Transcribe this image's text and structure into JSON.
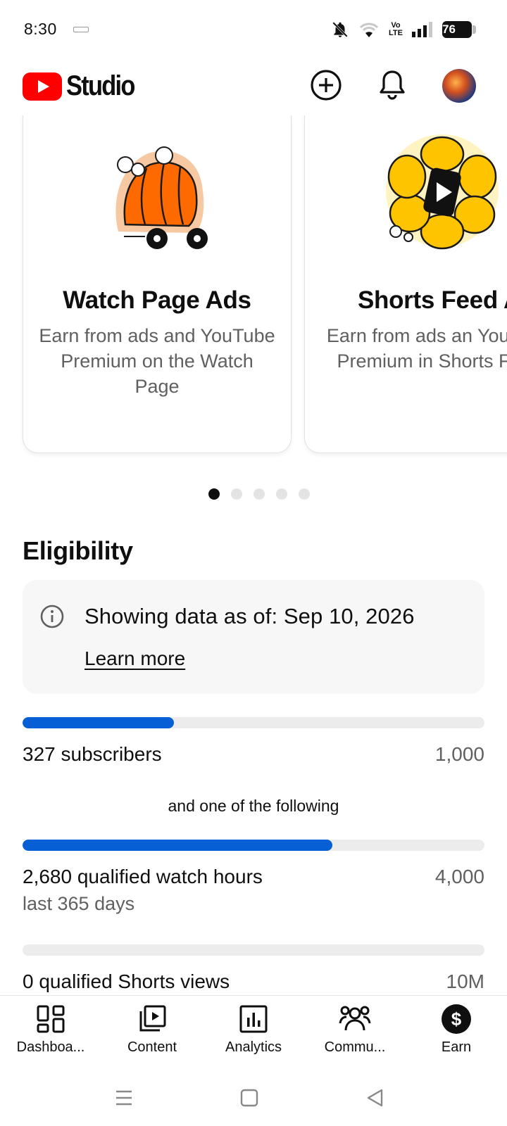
{
  "status_bar": {
    "time": "8:30",
    "network_label": "Vo\nLTE",
    "battery": "76",
    "icons": [
      "notifications-off-icon",
      "wifi-icon",
      "volte-icon",
      "signal-icon",
      "battery-icon"
    ]
  },
  "header": {
    "app_name": "Studio",
    "icons": [
      "create-icon",
      "notifications-icon",
      "avatar"
    ],
    "brand_color": "#ff0000"
  },
  "carousel": {
    "cards": [
      {
        "title": "Watch Page Ads",
        "description": "Earn from ads and YouTube Premium on the Watch Page",
        "illustration": "orange-wagon-illustration"
      },
      {
        "title": "Shorts Feed A",
        "description": "Earn from ads an YouTube Premium in Shorts Feed",
        "illustration": "yellow-shorts-illustration"
      }
    ],
    "page_count": 5,
    "active_page": 1
  },
  "eligibility": {
    "title": "Eligibility",
    "info_text": "Showing data as of: Sep 10, 2026",
    "learn_more": "Learn more",
    "subscribers": {
      "label": "327 subscribers",
      "target": "1,000",
      "progress": 0.327
    },
    "connector": "and one of the following",
    "watch_hours": {
      "label": "2,680 qualified watch hours",
      "sub": "last 365 days",
      "target": "4,000",
      "progress": 0.67
    },
    "shorts_views": {
      "label": "0 qualified Shorts views",
      "target": "10M",
      "progress": 0
    },
    "accent_color": "#065fd4"
  },
  "bottom_nav": {
    "items": [
      {
        "label": "Dashboa...",
        "icon": "dashboard-icon"
      },
      {
        "label": "Content",
        "icon": "content-icon"
      },
      {
        "label": "Analytics",
        "icon": "analytics-icon"
      },
      {
        "label": "Commu...",
        "icon": "community-icon"
      },
      {
        "label": "Earn",
        "icon": "earn-icon"
      }
    ],
    "active": "Earn"
  },
  "system_nav": {
    "icons": [
      "menu-icon",
      "home-icon",
      "back-icon"
    ]
  }
}
